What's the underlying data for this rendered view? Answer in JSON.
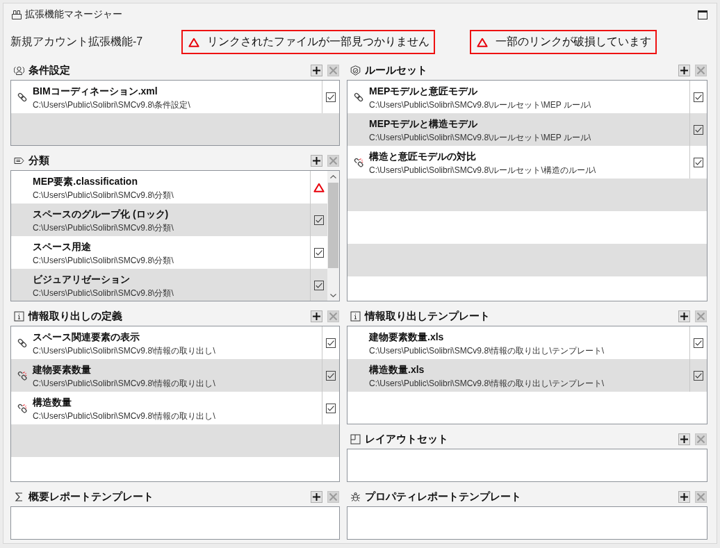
{
  "window": {
    "title": "拡張機能マネージャー"
  },
  "account_name": "新規アカウント拡張機能-7",
  "warnings": [
    {
      "text": "リンクされたファイルが一部見つかりません"
    },
    {
      "text": "一部のリンクが破損しています"
    }
  ],
  "panels": [
    {
      "title": "条件設定",
      "add_button": {
        "disabled": false
      },
      "remove_button": {
        "disabled": true
      },
      "scrollbar": false,
      "items": [
        {
          "kind": "linked",
          "name": "BIMコーディネーション.xml",
          "path": "C:\\Users\\Public\\Solibri\\SMCv9.8\\条件設定\\",
          "checked": true
        }
      ]
    },
    {
      "title": "ルールセット",
      "add_button": {
        "disabled": false
      },
      "remove_button": {
        "disabled": true
      },
      "scrollbar": false,
      "items": [
        {
          "kind": "linked",
          "name": "MEPモデルと意匠モデル",
          "path": "C:\\Users\\Public\\Solibri\\SMCv9.8\\ルールセット\\MEP ルール\\",
          "checked": true
        },
        {
          "kind": "plain",
          "name": "MEPモデルと構造モデル",
          "path": "C:\\Users\\Public\\Solibri\\SMCv9.8\\ルールセット\\MEP ルール\\",
          "checked": true
        },
        {
          "kind": "broken",
          "name": "構造と意匠モデルの対比",
          "path": "C:\\Users\\Public\\Solibri\\SMCv9.8\\ルールセット\\構造のルール\\",
          "checked": true
        }
      ]
    },
    {
      "title": "分類",
      "add_button": {
        "disabled": false
      },
      "remove_button": {
        "disabled": true
      },
      "scrollbar": true,
      "items": [
        {
          "kind": "missing",
          "name": "MEP要素.classification",
          "path": "C:\\Users\\Public\\Solibri\\SMCv9.8\\分類\\"
        },
        {
          "kind": "plain",
          "name": "スペースのグループ化 (ロック)",
          "path": "C:\\Users\\Public\\Solibri\\SMCv9.8\\分類\\",
          "checked": true
        },
        {
          "kind": "plain",
          "name": "スペース用途",
          "path": "C:\\Users\\Public\\Solibri\\SMCv9.8\\分類\\",
          "checked": true
        },
        {
          "kind": "plain",
          "name": "ビジュアリゼーション",
          "path": "C:\\Users\\Public\\Solibri\\SMCv9.8\\分類\\",
          "checked": true
        }
      ]
    },
    {
      "title": "情報取り出しの定義",
      "add_button": {
        "disabled": false
      },
      "remove_button": {
        "disabled": true
      },
      "scrollbar": false,
      "items": [
        {
          "kind": "linked",
          "name": "スペース関連要素の表示",
          "path": "C:\\Users\\Public\\Solibri\\SMCv9.8\\情報の取り出し\\",
          "checked": true
        },
        {
          "kind": "broken",
          "name": "建物要素数量",
          "path": "C:\\Users\\Public\\Solibri\\SMCv9.8\\情報の取り出し\\",
          "checked": true
        },
        {
          "kind": "broken",
          "name": "構造数量",
          "path": "C:\\Users\\Public\\Solibri\\SMCv9.8\\情報の取り出し\\",
          "checked": true
        }
      ]
    },
    {
      "title": "情報取り出しテンプレート",
      "add_button": {
        "disabled": false
      },
      "remove_button": {
        "disabled": true
      },
      "scrollbar": false,
      "items": [
        {
          "kind": "plain",
          "name": "建物要素数量.xls",
          "path": "C:\\Users\\Public\\Solibri\\SMCv9.8\\情報の取り出し\\テンプレート\\",
          "checked": true
        },
        {
          "kind": "plain",
          "name": "構造数量.xls",
          "path": "C:\\Users\\Public\\Solibri\\SMCv9.8\\情報の取り出し\\テンプレート\\",
          "checked": true
        }
      ]
    },
    {
      "title": "レイアウトセット",
      "add_button": {
        "disabled": false
      },
      "remove_button": {
        "disabled": true
      },
      "scrollbar": false
    },
    {
      "title": "概要レポートテンプレート",
      "add_button": {
        "disabled": false
      },
      "remove_button": {
        "disabled": true
      },
      "scrollbar": false
    },
    {
      "title": "プロパティレポートテンプレート",
      "add_button": {
        "disabled": false
      },
      "remove_button": {
        "disabled": true
      },
      "scrollbar": false
    }
  ]
}
